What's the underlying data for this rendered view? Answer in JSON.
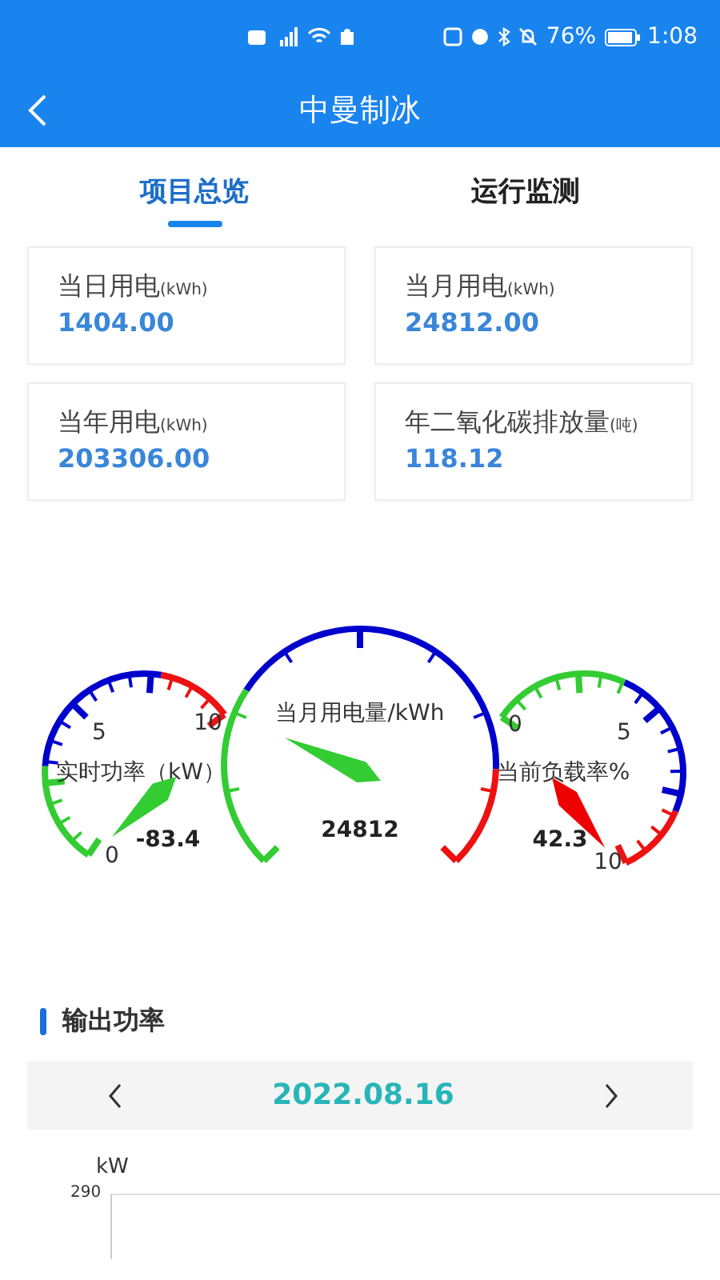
{
  "status_bar": {
    "battery": "76%",
    "time": "1:08"
  },
  "app_bar": {
    "title": "中曼制冰"
  },
  "tabs": [
    {
      "label": "项目总览",
      "selected": true
    },
    {
      "label": "运行监测",
      "selected": false
    }
  ],
  "stats": [
    {
      "label": "当日用电",
      "unit": "(kWh)",
      "value": "1404.00"
    },
    {
      "label": "当月用电",
      "unit": "(kWh)",
      "value": "24812.00"
    },
    {
      "label": "当年用电",
      "unit": "(kWh)",
      "value": "203306.00"
    },
    {
      "label": "年二氧化碳排放量",
      "unit": "(吨)",
      "value": "118.12"
    }
  ],
  "gauges": [
    {
      "title": "实时功率（kW）",
      "value": "-83.4",
      "color": "#33cc33",
      "tick_labels": [
        "0",
        "5",
        "10"
      ]
    },
    {
      "title": "当月用电量/kWh",
      "value": "24812",
      "color": "#33cc33"
    },
    {
      "title": "当前负载率%",
      "value": "42.3",
      "color": "#ee0000",
      "tick_labels": [
        "0",
        "5",
        "10"
      ]
    }
  ],
  "section": {
    "title": "输出功率",
    "date": "2022.08.16",
    "chart": {
      "unit": "kW",
      "top_tick": "290"
    }
  }
}
